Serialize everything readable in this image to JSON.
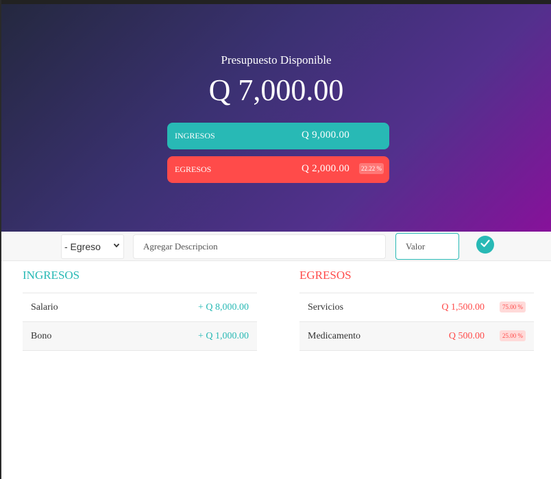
{
  "header": {
    "title": "Presupuesto Disponible",
    "budget": "Q 7,000.00",
    "income_label": "INGRESOS",
    "income_total": "Q 9,000.00",
    "expense_label": "EGRESOS",
    "expense_total": "Q 2,000.00",
    "expense_percentage": "22.22 %"
  },
  "add_bar": {
    "type_selected": "- Egreso",
    "description_placeholder": "Agregar Descripcion",
    "value_placeholder": "Valor"
  },
  "income_list": {
    "title": "INGRESOS",
    "items": [
      {
        "description": "Salario",
        "amount": "+ Q 8,000.00"
      },
      {
        "description": "Bono",
        "amount": "+ Q 1,000.00"
      }
    ]
  },
  "expense_list": {
    "title": "EGRESOS",
    "items": [
      {
        "description": "Servicios",
        "amount": "Q 1,500.00",
        "percentage": "75.00 %"
      },
      {
        "description": "Medicamento",
        "amount": "Q 500.00",
        "percentage": "25.00 %"
      }
    ]
  },
  "colors": {
    "income": "#28b9b5",
    "expense": "#ff4b4a"
  }
}
